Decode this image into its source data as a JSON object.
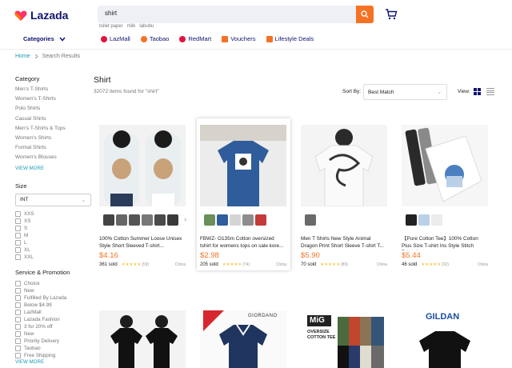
{
  "header": {
    "logo_text": "Lazada",
    "search_value": "shirt",
    "suggestions": [
      "toilet paper",
      "milk",
      "labubu"
    ],
    "categories_label": "Categories",
    "nav": [
      {
        "label": "LazMall",
        "color": "#e3133f"
      },
      {
        "label": "Taobao",
        "color": "#f57224"
      },
      {
        "label": "RedMart",
        "color": "#e3133f"
      },
      {
        "label": "Vouchers",
        "color": "#f57224"
      },
      {
        "label": "Lifestyle Deals",
        "color": "#f57224"
      }
    ]
  },
  "breadcrumb": {
    "home": "Home",
    "current": "Search Results"
  },
  "sidebar": {
    "category_title": "Category",
    "categories": [
      "Men's T-Shirts",
      "Women's T-Shirts",
      "Polo Shirts",
      "Casual Shirts",
      "Men's T-Shirts & Tops",
      "Women's Shirts",
      "Formal Shirts",
      "Women's Blouses"
    ],
    "view_more": "VIEW MORE",
    "size_title": "Size",
    "size_select": "INT",
    "sizes": [
      "XXS",
      "XS",
      "S",
      "M",
      "L",
      "XL",
      "XXL"
    ],
    "service_title": "Service & Promotion",
    "services": [
      "Choice",
      "New",
      "Fulfilled By Lazada",
      "Below $4.99",
      "LazMall",
      "Lazada Fashion",
      "3 for 20% off",
      "New",
      "Priority Delivery",
      "Taobao",
      "Free Shipping"
    ],
    "view_more_2": "VIEW MORE"
  },
  "results": {
    "title": "Shirt",
    "count_text": "32072 items found for \"shirt\"",
    "sort_label": "Sort By:",
    "sort_value": "Best Match",
    "view_label": "View:"
  },
  "products": [
    {
      "name": "100% Cotton Summer Loose Unisex Style Short Sleeved T-shirt...",
      "price": "$4.16",
      "sold": "361 sold",
      "stars": "★★★★★",
      "reviews": "(59)",
      "country": "China"
    },
    {
      "name": "FBWZ- O135m Cotton oversized tshirt for womens tops on sale kore...",
      "price": "$2.98",
      "sold": "205 sold",
      "stars": "★★★★★",
      "reviews": "(74)",
      "country": "China"
    },
    {
      "name": "Men T Shirts New Style Animal Dragon Print Short Sleeve T-shirt T...",
      "price": "$5.90",
      "sold": "70 sold",
      "stars": "★★★★★",
      "reviews": "(89)",
      "country": "China"
    },
    {
      "name": "【Pure Cotton Tee】100% Cotton Plus Size T-shirt Ins Style Stitch Printed ...",
      "price": "$5.44",
      "sold": "46 sold",
      "stars": "★★★★★",
      "reviews": "(32)",
      "country": "China"
    }
  ],
  "bottom_brands": {
    "giordano": "GIORDANO",
    "mig": "MiG",
    "gildan": "GILDAN",
    "oversize": "OVERSIZE COTTON TEE"
  },
  "colors": {
    "brand_orange": "#f57224",
    "nav_blue": "#0f136d",
    "link_teal": "#1a9cb7"
  }
}
